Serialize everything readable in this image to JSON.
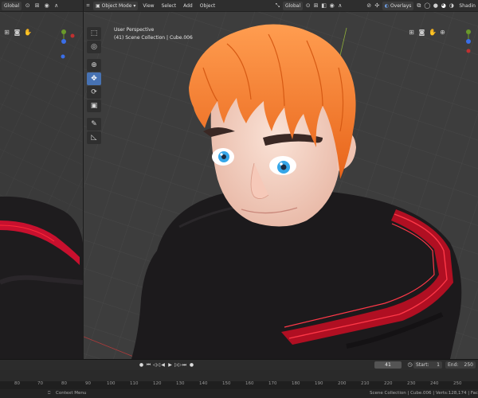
{
  "left_header": {
    "orientation": "Global",
    "icons": [
      "transform-pivot-icon",
      "snap-icon",
      "proportional-icon",
      "overflow-icon"
    ]
  },
  "main_header": {
    "mode": "Object Mode",
    "menus": [
      "View",
      "Select",
      "Add",
      "Object"
    ],
    "orientation": "Global",
    "overlays_label": "Overlays",
    "shading_label": "Shadin"
  },
  "viewport": {
    "perspective": "User Perspective",
    "collection": "(41) Scene Collection | Cube.006"
  },
  "toolbar": {
    "tools": [
      {
        "name": "select-box-tool",
        "glyph": "⬚"
      },
      {
        "name": "cursor-tool",
        "glyph": "◎"
      },
      {
        "name": "move-tool",
        "glyph": "✥",
        "active": true
      },
      {
        "name": "rotate-tool",
        "glyph": "⟳"
      },
      {
        "name": "scale-tool",
        "glyph": "▣"
      },
      {
        "name": "transform-tool",
        "glyph": "⬓"
      },
      {
        "name": "annotate-tool",
        "glyph": "✎"
      },
      {
        "name": "measure-tool",
        "glyph": "📐"
      }
    ]
  },
  "timeline": {
    "current_frame": "41",
    "start_label": "Start:",
    "start_value": "1",
    "end_label": "End:",
    "end_value": "250",
    "ticks": [
      "80",
      "70",
      "80",
      "90",
      "100",
      "110",
      "120",
      "130",
      "140",
      "150",
      "160",
      "170",
      "180",
      "190",
      "200",
      "210",
      "220",
      "230",
      "240",
      "250"
    ]
  },
  "statusbar": {
    "context_menu": "Context Menu",
    "stats": "Scene Collection | Cube.006 | Verts:128,174 | Faces:"
  },
  "colors": {
    "accent_blue": "#4772b3",
    "hair_orange": "#f07a2a",
    "shirt_black": "#1c1a1c",
    "stripe_red": "#c8102e"
  }
}
